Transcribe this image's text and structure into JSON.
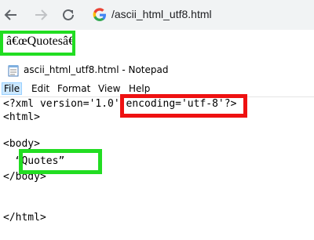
{
  "browser": {
    "url": "/ascii_html_utf8.html",
    "back_icon": "arrow-left-icon",
    "forward_icon": "arrow-right-icon",
    "reload_icon": "reload-icon",
    "search_icon": "google-g-icon"
  },
  "page": {
    "rendered_text": "â€œQuotesâ€"
  },
  "notepad": {
    "title": "ascii_html_utf8.html - Notepad",
    "menu": [
      "File",
      "Edit",
      "Format",
      "View",
      "Help"
    ],
    "lines": [
      "<?xml version='1.0' encoding='utf-8'?>",
      "<html>",
      "",
      "<body>",
      "  “Quotes”",
      "</body>",
      "",
      "</html>"
    ]
  },
  "colors": {
    "highlight_green": "#22dd22",
    "highlight_red": "#ee1111",
    "toolbar_bg": "#f1f3f4"
  }
}
